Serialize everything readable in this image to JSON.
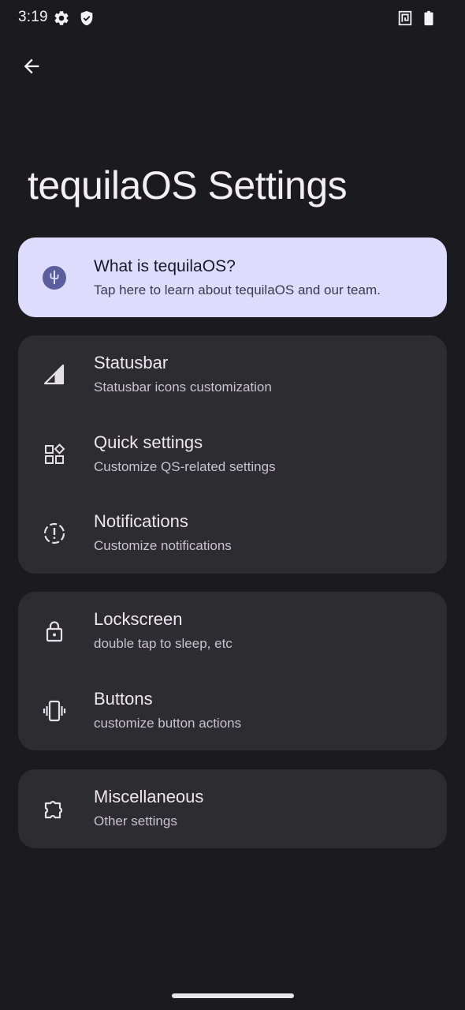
{
  "status_bar": {
    "time": "3:19",
    "icons": [
      "gear-icon",
      "shield-icon",
      "nfc-icon",
      "battery-icon"
    ]
  },
  "header": {
    "back_icon": "back-arrow-icon",
    "title": "tequilaOS Settings"
  },
  "about_card": {
    "icon": "cactus-icon",
    "title": "What is tequilaOS?",
    "summary": "Tap here to learn about tequilaOS and our team.",
    "background": "#dddcfc"
  },
  "groups": [
    {
      "items": [
        {
          "icon": "signal-icon",
          "title": "Statusbar",
          "summary": "Statusbar icons customization"
        },
        {
          "icon": "quick-settings-icon",
          "title": "Quick settings",
          "summary": "Customize QS-related settings"
        },
        {
          "icon": "notification-alert-icon",
          "title": "Notifications",
          "summary": "Customize notifications"
        }
      ]
    },
    {
      "items": [
        {
          "icon": "lock-icon",
          "title": "Lockscreen",
          "summary": "double tap to sleep, etc"
        },
        {
          "icon": "vibrate-phone-icon",
          "title": "Buttons",
          "summary": "customize button actions"
        }
      ]
    },
    {
      "items": [
        {
          "icon": "puzzle-icon",
          "title": "Miscellaneous",
          "summary": "Other settings"
        }
      ]
    }
  ],
  "colors": {
    "background": "#1b1b1f",
    "card": "#2c2c31",
    "accent_card": "#dddcfc",
    "accent_icon": "#5b5d9c"
  }
}
